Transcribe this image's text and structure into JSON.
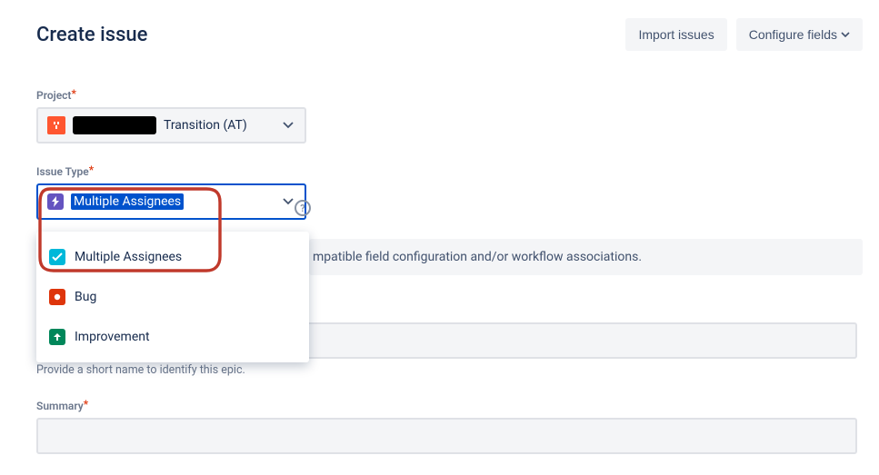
{
  "header": {
    "title": "Create issue",
    "import_button": "Import issues",
    "configure_button": "Configure fields"
  },
  "project": {
    "label": "Project",
    "value_suffix": "Transition (AT)"
  },
  "issue_type": {
    "label": "Issue Type",
    "selected": "Multiple Assignees",
    "options": [
      {
        "label": "Multiple Assignees"
      },
      {
        "label": "Bug"
      },
      {
        "label": "Improvement"
      }
    ],
    "help_glyph": "?"
  },
  "hint_partial": "mpatible field configuration and/or workflow associations.",
  "epic_helper": "Provide a short name to identify this epic.",
  "summary": {
    "label": "Summary"
  }
}
